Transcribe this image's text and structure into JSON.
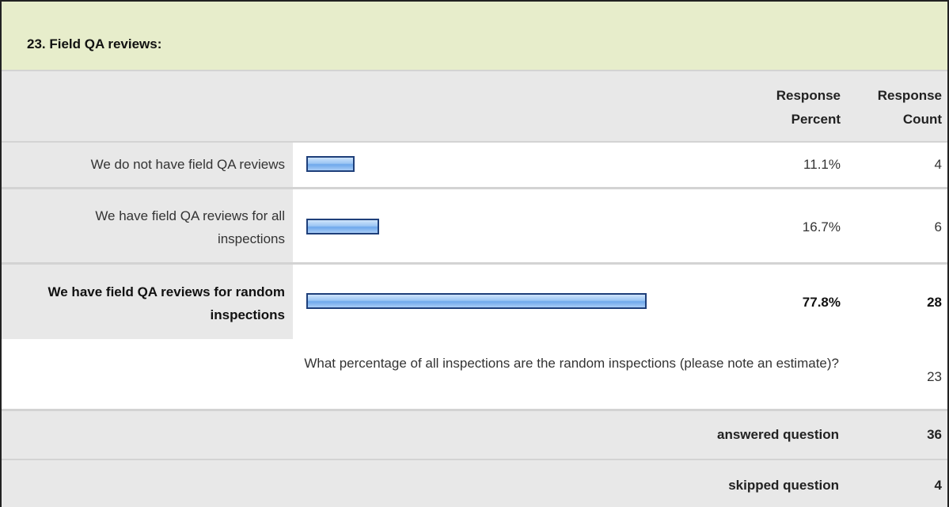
{
  "question": {
    "title": "23. Field QA reviews:"
  },
  "headers": {
    "percent": "Response Percent",
    "count": "Response Count"
  },
  "chart_data": {
    "type": "bar",
    "orientation": "horizontal",
    "categories": [
      "We do not have field QA reviews",
      "We have field QA reviews for all inspections",
      "We have field QA reviews for random inspections"
    ],
    "values": [
      11.1,
      16.7,
      77.8
    ],
    "counts": [
      4,
      6,
      28
    ],
    "value_labels": [
      "11.1%",
      "16.7%",
      "77.8%"
    ],
    "count_labels": [
      "4",
      "6",
      "28"
    ],
    "bar_color": "#7fb3f0",
    "bar_border": "#1e3f7a",
    "xlim": [
      0,
      100
    ]
  },
  "rows": [
    {
      "label": "We do not have field QA reviews",
      "percent": "11.1%",
      "count": "4"
    },
    {
      "label": "We have field QA reviews for all inspections",
      "percent": "16.7%",
      "count": "6"
    },
    {
      "label": "We have field QA reviews for random inspections",
      "percent": "77.8%",
      "count": "28"
    }
  ],
  "open_response": {
    "text": "What percentage of all inspections are the random inspections (please note an estimate)?",
    "count": "23"
  },
  "summary": {
    "answered_label": "answered question",
    "answered_value": "36",
    "skipped_label": "skipped question",
    "skipped_value": "4"
  },
  "colors": {
    "title_bg": "#e7edcb",
    "row_bg": "#e8e8e8",
    "border": "#222222"
  }
}
